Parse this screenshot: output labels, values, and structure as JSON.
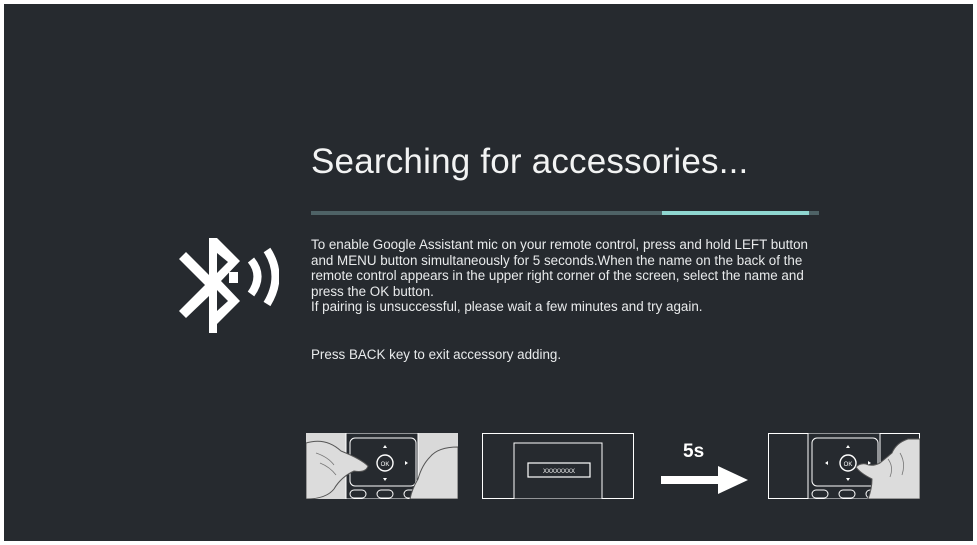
{
  "title": "Searching for accessories...",
  "progress": {
    "start_fraction": 0.69,
    "end_fraction": 0.98
  },
  "instructions": {
    "line1": "To enable Google Assistant mic on your remote control, press and hold LEFT button and MENU button simultaneously for 5 seconds.When the name on the back of the remote control appears in the upper right corner of the screen, select the name and press the OK button.",
    "line2": "If pairing is unsuccessful, please wait a few minutes and try again."
  },
  "back_hint": "Press BACK key to exit accessory adding.",
  "steps": {
    "step1_ok_label": "OK",
    "step2_screen_text": "XXXXXXXX",
    "step3_ok_label": "OK",
    "hold_duration": "5s"
  },
  "icons": {
    "main": "bluetooth-searching-icon",
    "arrow": "arrow-right-icon"
  },
  "colors": {
    "background": "#262a2f",
    "progress_track": "#4e6266",
    "progress_fill": "#8fd6d0",
    "text": "#f2f3f3"
  }
}
